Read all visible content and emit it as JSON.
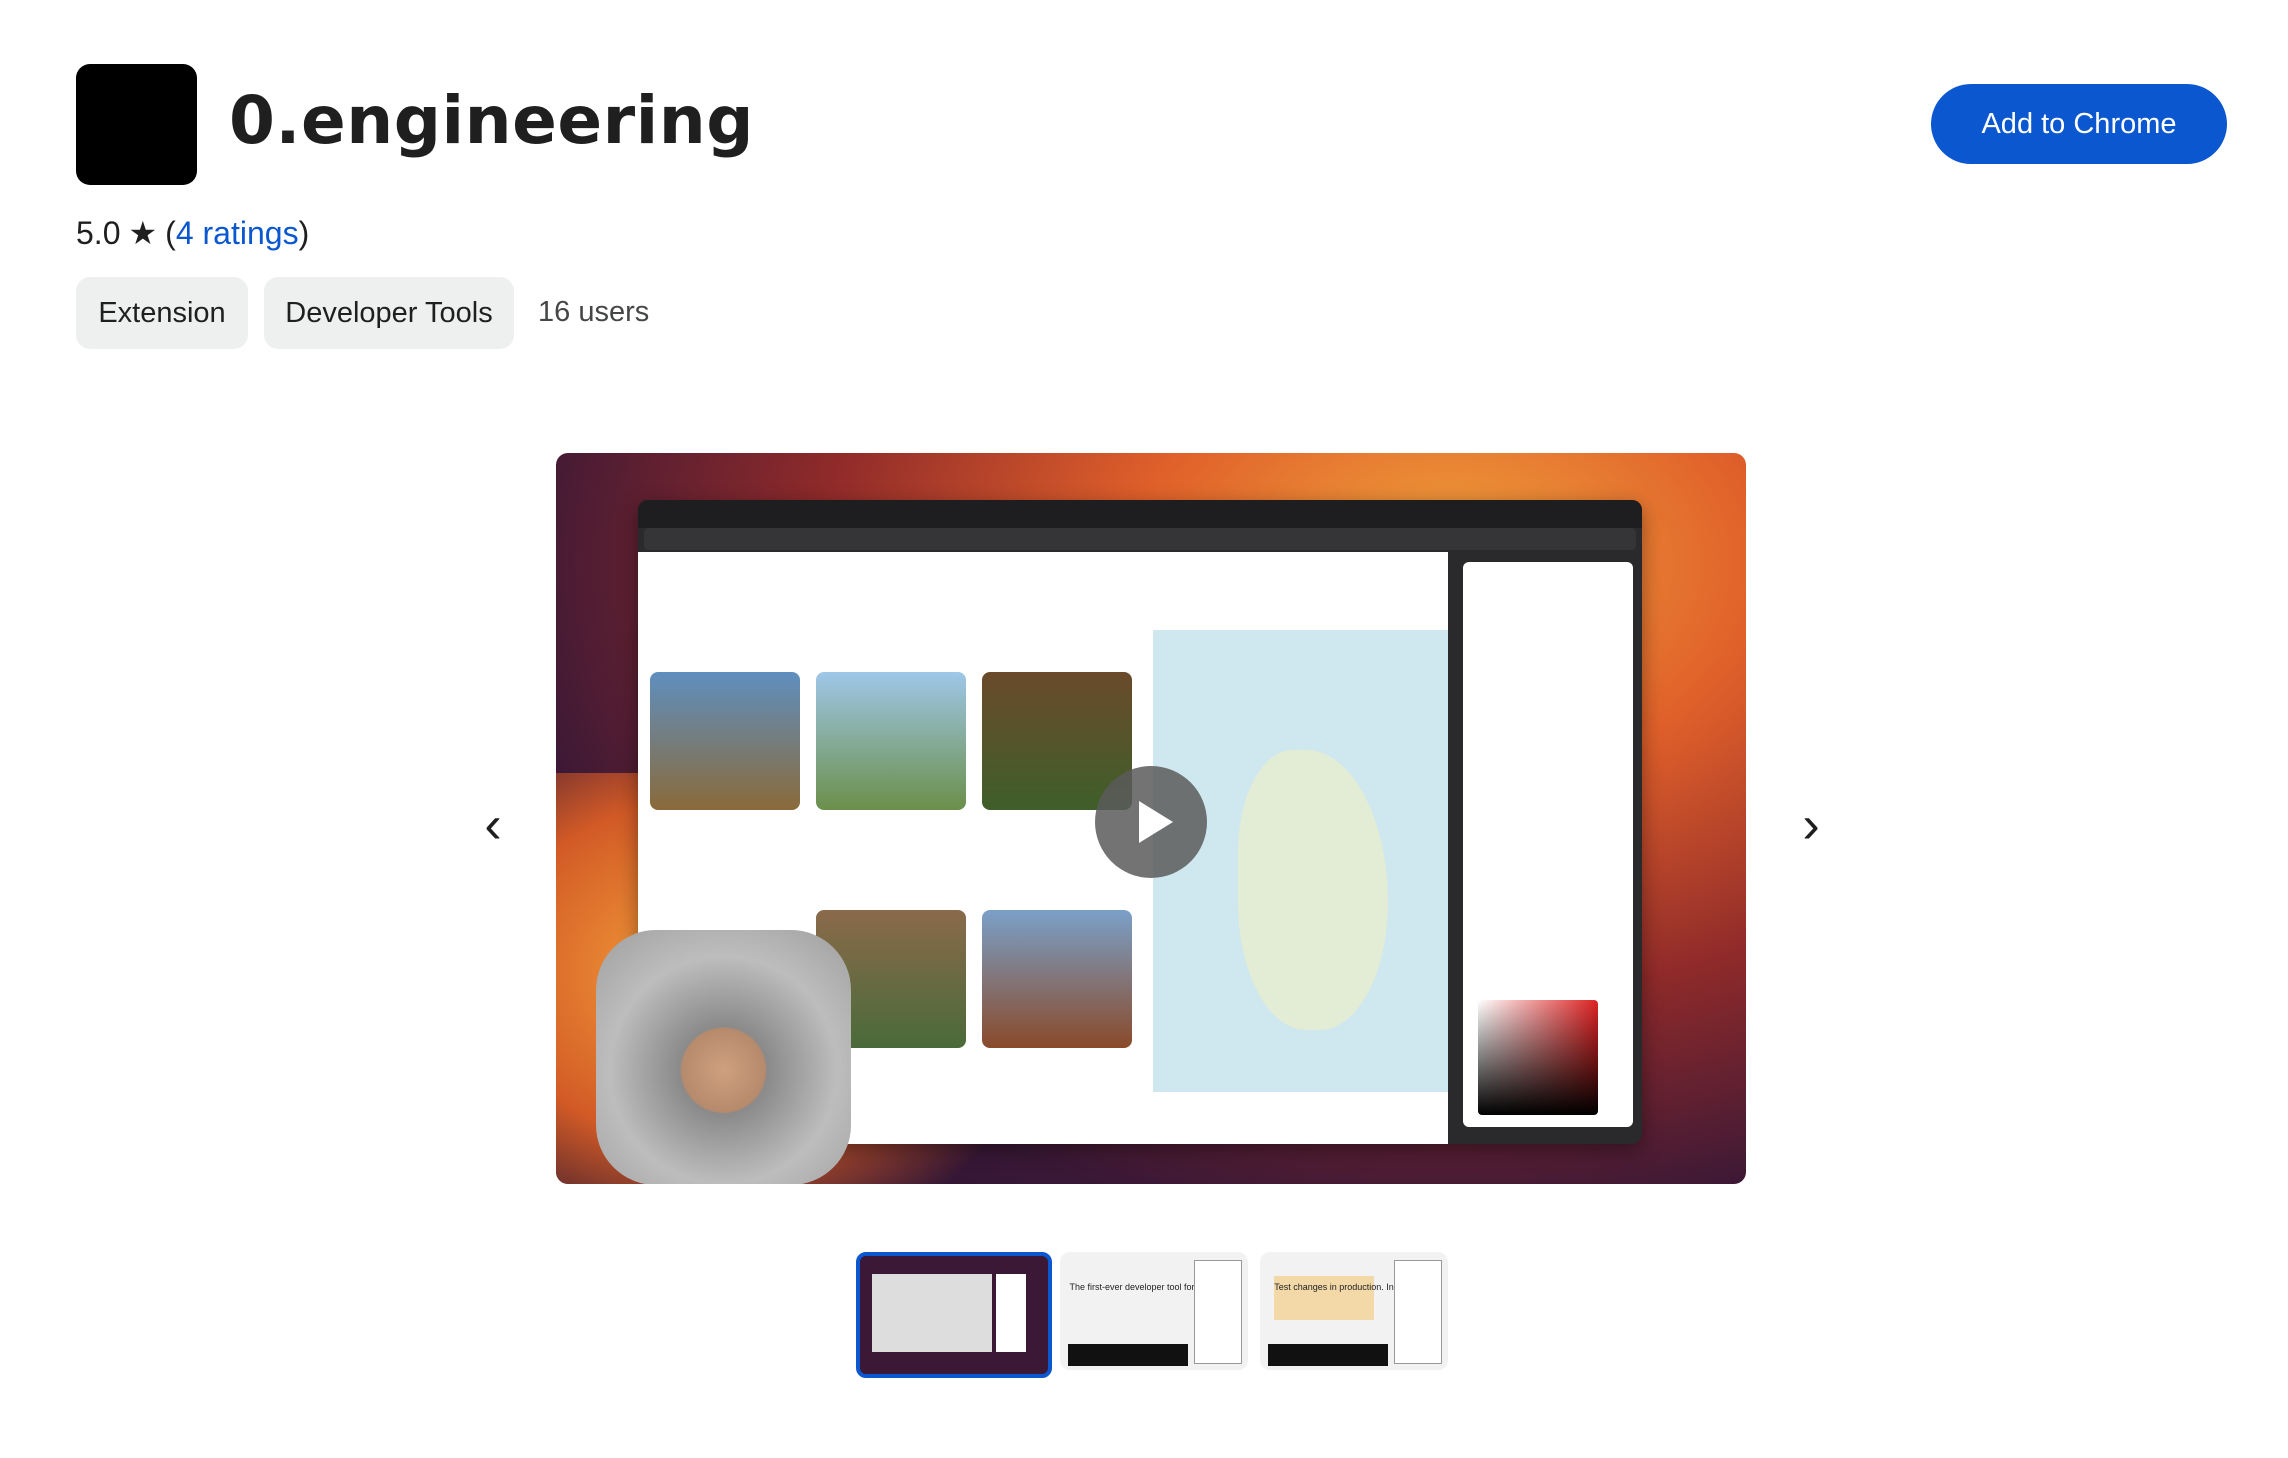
{
  "extension": {
    "title": "0.engineering",
    "rating_value": "5.0",
    "rating_star": "★",
    "ratings_link": "4 ratings",
    "chips": [
      "Extension",
      "Developer Tools"
    ],
    "users": "16 users"
  },
  "actions": {
    "add_label": "Add to Chrome"
  },
  "carousel": {
    "prev_icon": "‹",
    "next_icon": "›",
    "thumbnails": [
      {
        "caption": "",
        "active": true
      },
      {
        "caption": "The first-ever developer tool for designers.",
        "active": false
      },
      {
        "caption": "Test changes in production. In real-time.",
        "active": false
      }
    ]
  },
  "colors": {
    "accent": "#0b57d0",
    "chip_bg": "#eef0f0"
  }
}
